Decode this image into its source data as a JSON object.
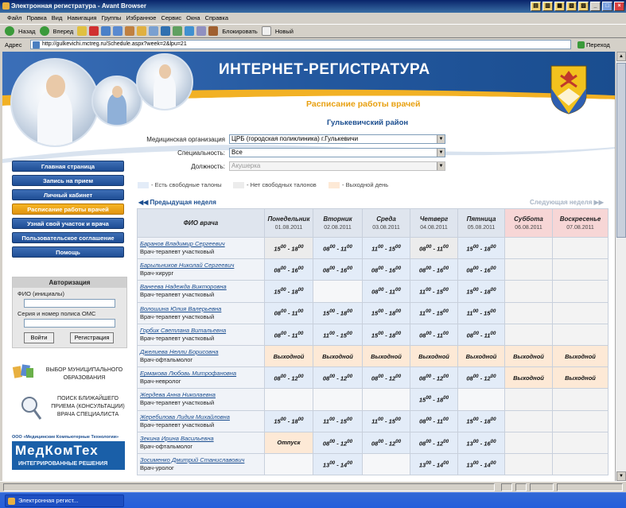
{
  "window": {
    "title": "Электронная регистратура - Avant Browser",
    "controls": [
      "_",
      "□",
      "×"
    ]
  },
  "menu": [
    "Файл",
    "Правка",
    "Вид",
    "Навигация",
    "Группы",
    "Избранное",
    "Сервис",
    "Окна",
    "Справка"
  ],
  "toolbar": {
    "back": "Назад",
    "forward": "Вперед",
    "block": "Блокировать",
    "new": "Новый"
  },
  "address": {
    "label": "Адрес",
    "url": "http://gulkevichi.mctreg.ru/Schedule.aspx?week=2&lpu=21",
    "go": "Переход"
  },
  "page": {
    "banner_title": "ИНТЕРНЕТ-РЕГИСТРАТУРА",
    "subtitle": "Расписание работы врачей",
    "district": "Гулькевичский район",
    "filters": {
      "org_label": "Медицинская организация",
      "org_value": "ЦРБ (городская поликлиника) г.Гулькевичи",
      "spec_label": "Специальность:",
      "spec_value": "Все",
      "pos_label": "Должность:",
      "pos_value": "Акушерка"
    },
    "legend": {
      "free": "- Есть свободные талоны",
      "none": "- Нет свободных талонов",
      "off": "- Выходной день"
    },
    "nav": [
      {
        "label": "Главная страница",
        "active": false
      },
      {
        "label": "Запись на прием",
        "active": false
      },
      {
        "label": "Личный кабинет",
        "active": false
      },
      {
        "label": "Расписание работы врачей",
        "active": true
      },
      {
        "label": "Узнай свой участок и врача",
        "active": false
      },
      {
        "label": "Пользовательское соглашение",
        "active": false
      },
      {
        "label": "Помощь",
        "active": false
      }
    ],
    "auth": {
      "title": "Авторизация",
      "fio_label": "ФИО (инициалы)",
      "policy_label": "Серия и номер полиса ОМС",
      "login": "Войти",
      "register": "Регистрация"
    },
    "promos": {
      "municipal_1": "ВЫБОР МУНИЦИПАЛЬНОГО",
      "municipal_2": "ОБРАЗОВАНИЯ",
      "search_1": "ПОИСК БЛИЖАЙШЕГО",
      "search_2": "ПРИЕМА (КОНСУЛЬТАЦИИ)",
      "search_3": "ВРАЧА СПЕЦИАЛИСТА"
    },
    "brand": {
      "top": "ООО «Медицинские Компьютерные Технологии»",
      "name": "МедКомТех",
      "slogan": "ИНТЕГРИРОВАННЫЕ РЕШЕНИЯ"
    },
    "schedule": {
      "prev_week": "Предыдущая неделя",
      "next_week": "Следующая неделя",
      "name_header": "ФИО врача",
      "days": [
        {
          "name": "Понедельник",
          "date": "01.08.2011",
          "weekend": false
        },
        {
          "name": "Вторник",
          "date": "02.08.2011",
          "weekend": false
        },
        {
          "name": "Среда",
          "date": "03.08.2011",
          "weekend": false
        },
        {
          "name": "Четверг",
          "date": "04.08.2011",
          "weekend": false
        },
        {
          "name": "Пятница",
          "date": "05.08.2011",
          "weekend": false
        },
        {
          "name": "Суббота",
          "date": "06.08.2011",
          "weekend": true
        },
        {
          "name": "Воскресенье",
          "date": "07.08.2011",
          "weekend": true
        }
      ],
      "rows": [
        {
          "doctor": "Баранов Владимир Сергеевич",
          "specialty": "Врач-терапевт участковый",
          "cells": [
            [
              "15",
              "18",
              "none"
            ],
            [
              "08",
              "11",
              "free"
            ],
            [
              "11",
              "15",
              "free"
            ],
            [
              "08",
              "11",
              "none"
            ],
            [
              "15",
              "18",
              "free"
            ],
            null,
            null
          ]
        },
        {
          "doctor": "Барыльников Николай Сергеевич",
          "specialty": "Врач-хирург",
          "cells": [
            [
              "08",
              "16",
              "free"
            ],
            [
              "08",
              "16",
              "free"
            ],
            [
              "08",
              "16",
              "free"
            ],
            [
              "08",
              "16",
              "free"
            ],
            [
              "08",
              "16",
              "free"
            ],
            null,
            null
          ]
        },
        {
          "doctor": "Ванеева Надежда Викторовна",
          "specialty": "Врач-терапевт участковый",
          "cells": [
            [
              "15",
              "18",
              "free"
            ],
            null,
            [
              "08",
              "11",
              "free"
            ],
            [
              "11",
              "15",
              "free"
            ],
            [
              "15",
              "18",
              "free"
            ],
            null,
            null
          ]
        },
        {
          "doctor": "Волошина Юлия Валерьевна",
          "specialty": "Врач-терапевт участковый",
          "cells": [
            [
              "08",
              "11",
              "free"
            ],
            [
              "15",
              "18",
              "free"
            ],
            [
              "15",
              "18",
              "free"
            ],
            [
              "11",
              "15",
              "free"
            ],
            [
              "11",
              "15",
              "free"
            ],
            null,
            null
          ]
        },
        {
          "doctor": "Горбик Светлана Витальевна",
          "specialty": "Врач-терапевт участковый",
          "cells": [
            [
              "08",
              "11",
              "free"
            ],
            [
              "11",
              "15",
              "free"
            ],
            [
              "15",
              "18",
              "free"
            ],
            [
              "08",
              "11",
              "free"
            ],
            [
              "08",
              "11",
              "free"
            ],
            null,
            null
          ]
        },
        {
          "doctor": "Джелиева Нелли Борисовна",
          "specialty": "Врач-офтальмолог",
          "cells": [
            [
              "Выходной",
              "",
              "off"
            ],
            [
              "Выходной",
              "",
              "off"
            ],
            [
              "Выходной",
              "",
              "off"
            ],
            [
              "Выходной",
              "",
              "off"
            ],
            [
              "Выходной",
              "",
              "off"
            ],
            [
              "Выходной",
              "",
              "off"
            ],
            [
              "Выходной",
              "",
              "off"
            ]
          ]
        },
        {
          "doctor": "Ермакова Любовь Митрофановна",
          "specialty": "Врач-невролог",
          "cells": [
            [
              "08",
              "12",
              "free"
            ],
            [
              "08",
              "12",
              "free"
            ],
            [
              "08",
              "12",
              "free"
            ],
            [
              "08",
              "12",
              "free"
            ],
            [
              "08",
              "12",
              "free"
            ],
            [
              "Выходной",
              "",
              "off"
            ],
            [
              "Выходной",
              "",
              "off"
            ]
          ]
        },
        {
          "doctor": "Жердева Анна Николаевна",
          "specialty": "Врач-терапевт участковый",
          "cells": [
            null,
            null,
            null,
            [
              "15",
              "18",
              "free"
            ],
            null,
            null,
            null
          ]
        },
        {
          "doctor": "Жеребилова Лидия Михайловна",
          "specialty": "Врач-терапевт участковый",
          "cells": [
            [
              "15",
              "18",
              "free"
            ],
            [
              "11",
              "15",
              "free"
            ],
            [
              "11",
              "15",
              "free"
            ],
            [
              "08",
              "11",
              "free"
            ],
            [
              "15",
              "18",
              "free"
            ],
            null,
            null
          ]
        },
        {
          "doctor": "Зекина Ирина Васильевна",
          "specialty": "Врач-офтальмолог",
          "cells": [
            [
              "Отпуск",
              "",
              "off"
            ],
            [
              "08",
              "12",
              "free"
            ],
            [
              "08",
              "12",
              "free"
            ],
            [
              "08",
              "12",
              "free"
            ],
            [
              "13",
              "16",
              "free"
            ],
            null,
            null
          ]
        },
        {
          "doctor": "Зосименко Дмитрий Станиславович",
          "specialty": "Врач-уролог",
          "cells": [
            null,
            [
              "13",
              "14",
              "free"
            ],
            null,
            [
              "13",
              "14",
              "free"
            ],
            [
              "13",
              "14",
              "free"
            ],
            null,
            null
          ]
        }
      ]
    }
  },
  "taskbar": {
    "item": "Электронная регист..."
  },
  "colors": {
    "banner": "#23589f",
    "accent": "#e8a010",
    "active_nav": "#f0a818",
    "free": "#e3ecf8",
    "none": "#ececec",
    "off": "#fde9d6"
  }
}
